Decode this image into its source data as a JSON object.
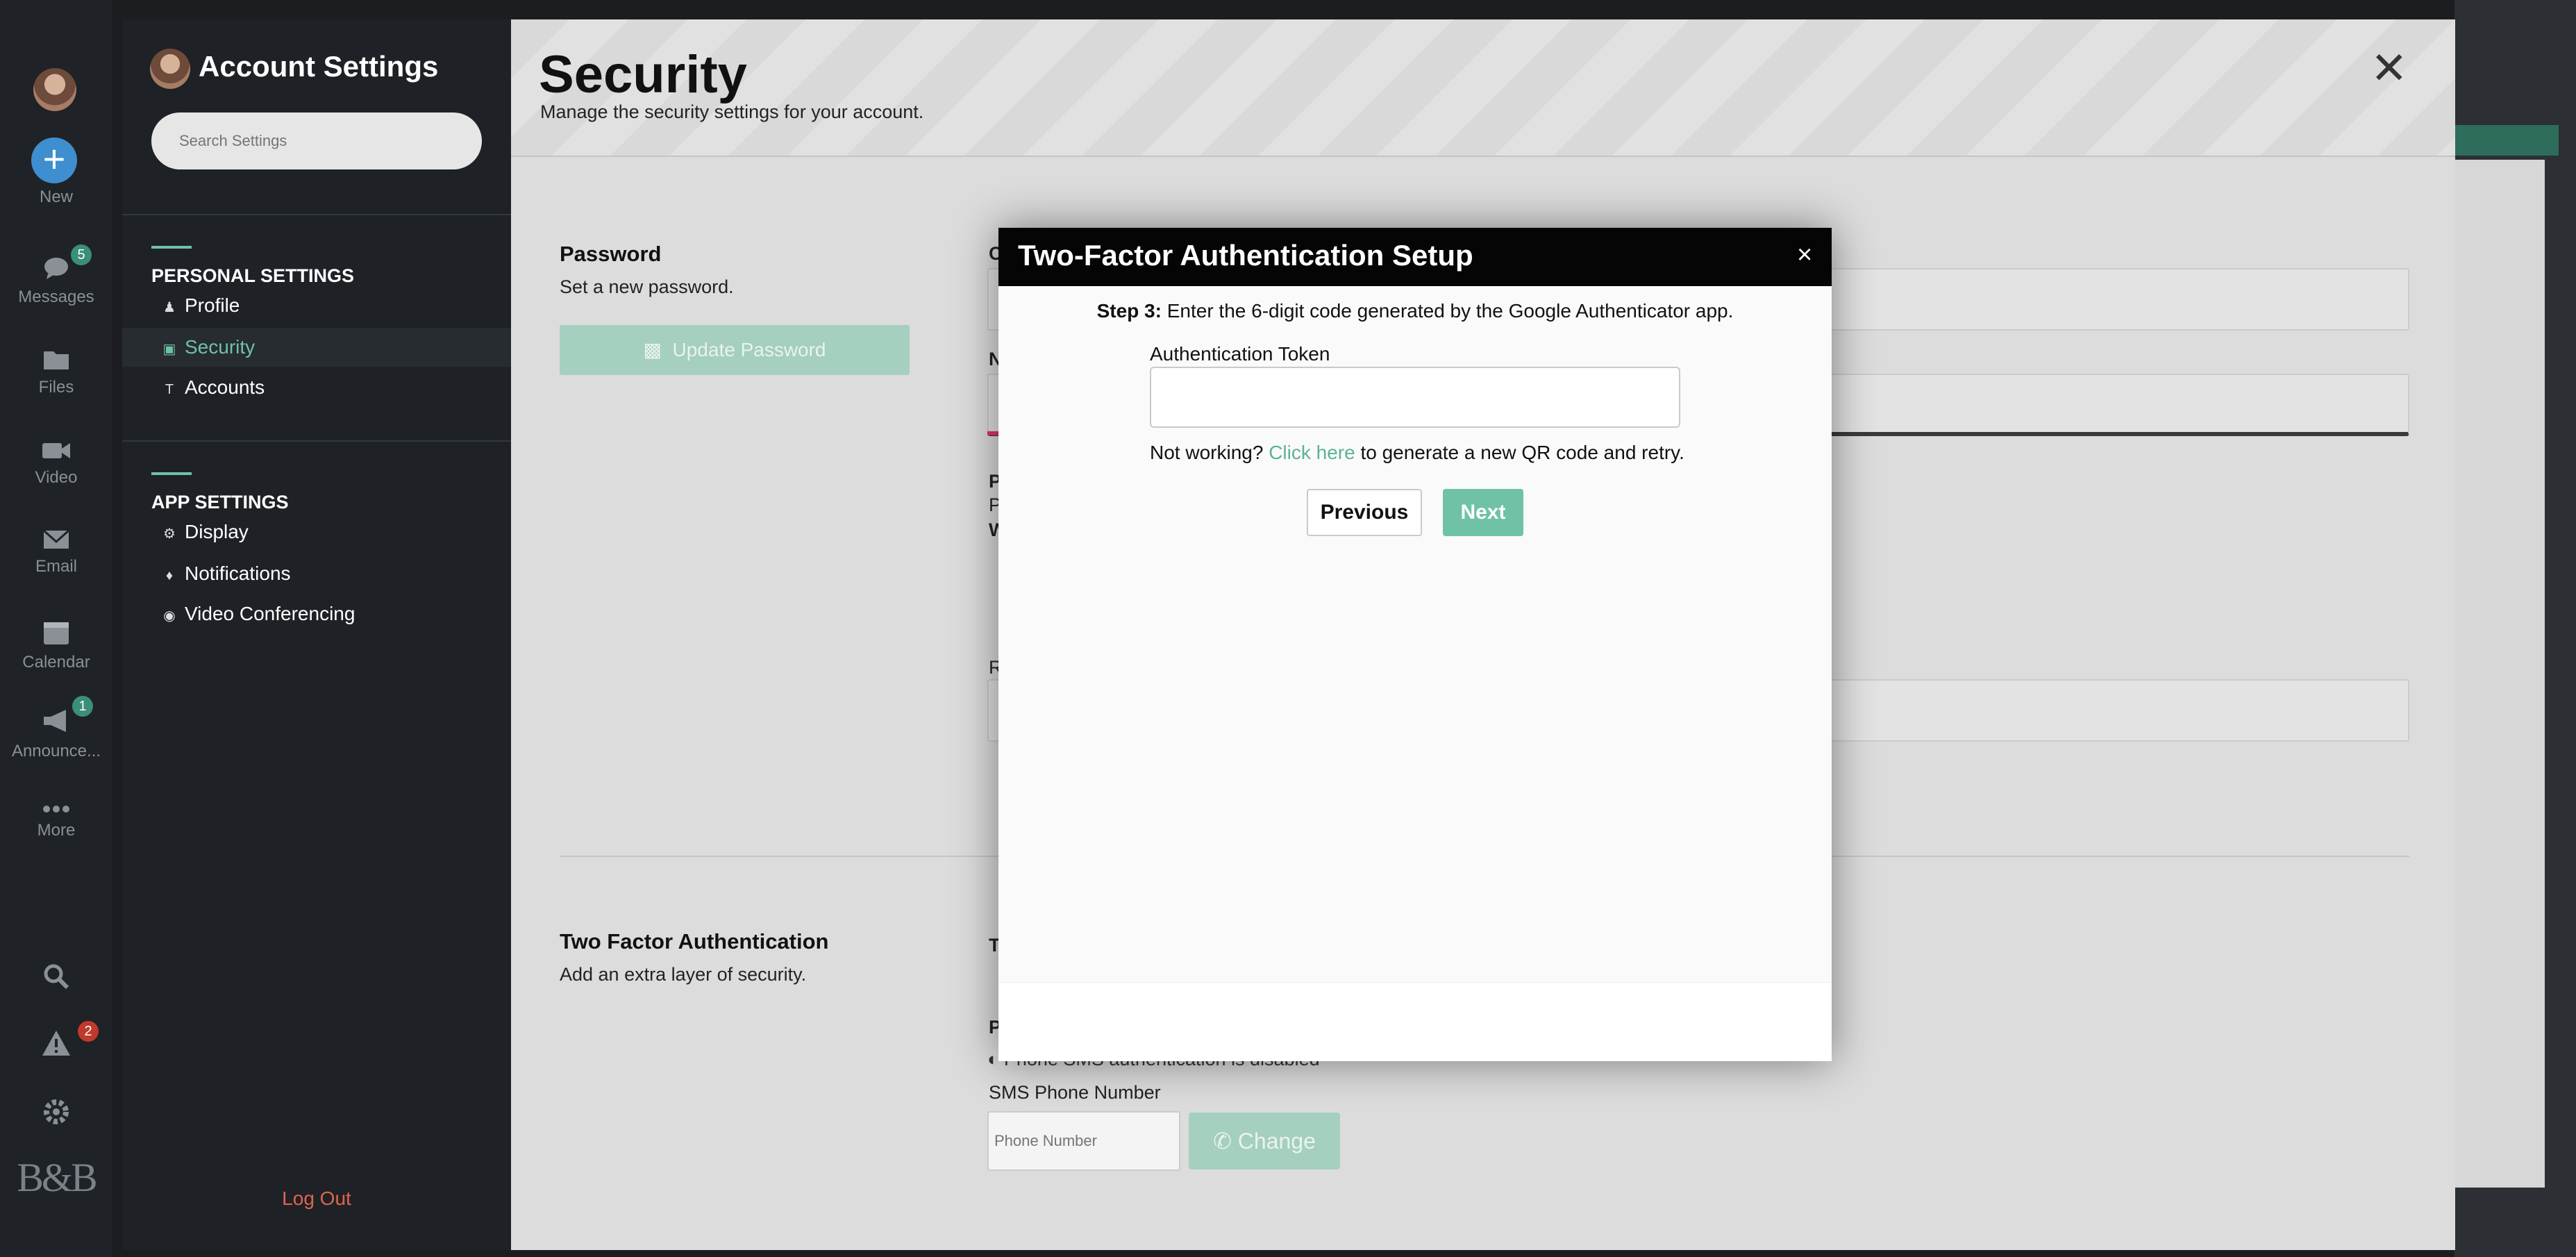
{
  "rail": {
    "new_label": "New",
    "items": [
      {
        "label": "Messages",
        "icon": "chat-icon",
        "badge": "5"
      },
      {
        "label": "Files",
        "icon": "folder-icon"
      },
      {
        "label": "Video",
        "icon": "video-camera-icon"
      },
      {
        "label": "Email",
        "icon": "envelope-icon"
      },
      {
        "label": "Calendar",
        "icon": "calendar-icon"
      },
      {
        "label": "Announce...",
        "icon": "megaphone-icon",
        "badge": "1"
      },
      {
        "label": "More",
        "icon": "more-dots-icon"
      }
    ],
    "alerts_badge": "2",
    "logo_text": "B&B"
  },
  "settings_sidebar": {
    "title": "Account Settings",
    "search_placeholder": "Search Settings",
    "personal_header": "PERSONAL SETTINGS",
    "personal_items": [
      {
        "label": "Profile",
        "icon": "person-icon"
      },
      {
        "label": "Security",
        "icon": "lock-icon",
        "active": true
      },
      {
        "label": "Accounts",
        "icon": "accounts-icon"
      }
    ],
    "app_header": "APP SETTINGS",
    "app_items": [
      {
        "label": "Display",
        "icon": "gear-icon"
      },
      {
        "label": "Notifications",
        "icon": "bell-icon"
      },
      {
        "label": "Video Conferencing",
        "icon": "camera-icon"
      }
    ],
    "logout_label": "Log Out"
  },
  "main": {
    "title": "Security",
    "subtitle": "Manage the security settings for your account.",
    "password": {
      "title": "Password",
      "desc": "Set a new password.",
      "update_button": "Update Password"
    },
    "two_factor": {
      "title": "Two Factor Authentication",
      "desc": "Add an extra layer of security.",
      "sms_status": "Phone SMS authentication is disabled",
      "sms_label": "SMS Phone Number",
      "phone_placeholder": "Phone Number",
      "change_button": "Change"
    },
    "partial_letters": [
      "C",
      "N",
      "P",
      "P",
      "W",
      "R",
      "T",
      "P"
    ]
  },
  "modal": {
    "title": "Two-Factor Authentication Setup",
    "close_glyph": "×",
    "step_label": "Step 3:",
    "step_text": " Enter the 6-digit code generated by the Google Authenticator app.",
    "token_label": "Authentication Token",
    "token_value": "",
    "not_working_prefix": "Not working? ",
    "not_working_link": "Click here",
    "not_working_suffix": " to generate a new QR code and retry.",
    "previous_button": "Previous",
    "next_button": "Next"
  },
  "colors": {
    "accent": "#6fc2a6",
    "modal_header": "#050505",
    "sidebar_bg": "#1e2226",
    "logout": "#e0644f"
  }
}
